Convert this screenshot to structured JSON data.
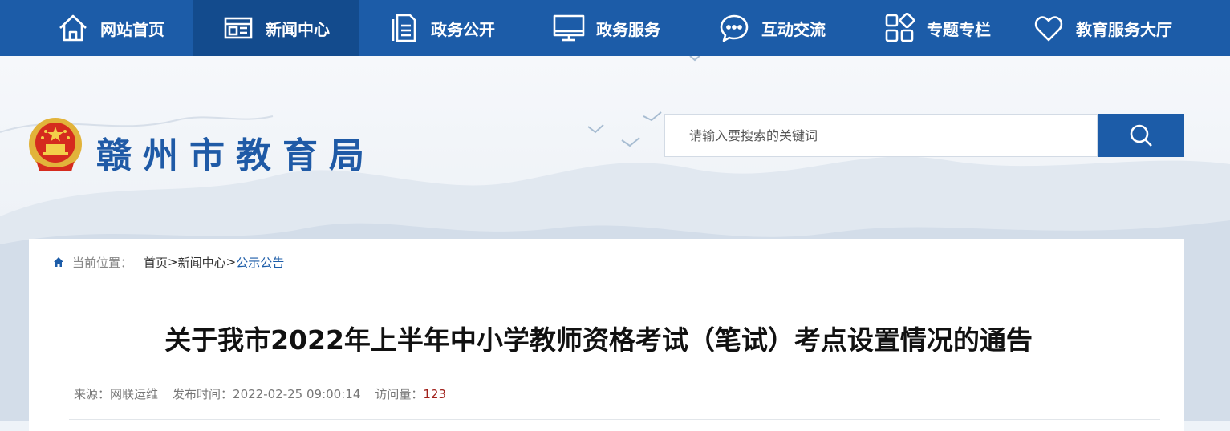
{
  "nav": {
    "items": [
      {
        "label": "网站首页",
        "icon": "home-icon"
      },
      {
        "label": "新闻中心",
        "icon": "news-icon"
      },
      {
        "label": "政务公开",
        "icon": "document-icon"
      },
      {
        "label": "政务服务",
        "icon": "monitor-icon"
      },
      {
        "label": "互动交流",
        "icon": "chat-icon"
      },
      {
        "label": "专题专栏",
        "icon": "grid-icon"
      },
      {
        "label": "教育服务大厅",
        "icon": "heart-icon"
      }
    ],
    "active_index": 1
  },
  "header": {
    "site_title": "赣州市教育局",
    "search_placeholder": "请输入要搜索的关键词"
  },
  "breadcrumb": {
    "label": "当前位置：",
    "items": [
      "首页",
      "新闻中心",
      "公示公告"
    ],
    "separator": ">"
  },
  "article": {
    "title": "关于我市2022年上半年中小学教师资格考试（笔试）考点设置情况的通告",
    "source_label": "来源：",
    "source": "网联运维",
    "published_label": "发布时间：",
    "published": "2022-02-25 09:00:14",
    "views_label": "访问量：",
    "views": "123"
  },
  "colors": {
    "nav_bg": "#1c5ca8",
    "nav_active": "#134b8d",
    "title_blue": "#1f5aa6",
    "views_red": "#a0201a"
  }
}
